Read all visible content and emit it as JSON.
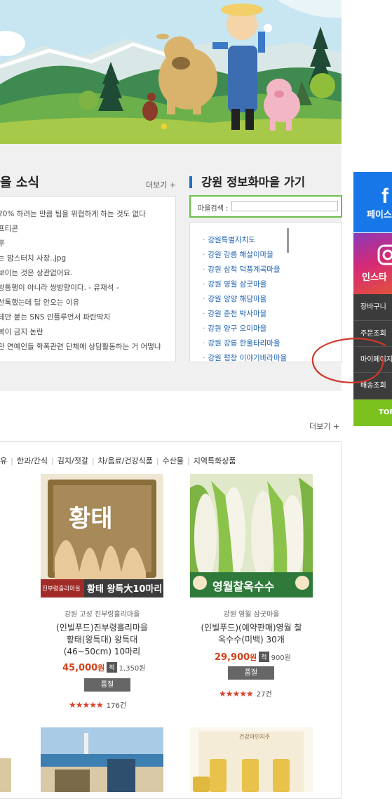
{
  "news": {
    "title": "을 소식",
    "more": "더보기 +",
    "items": [
      "20% 하려는 만큼 팀을 위협하게 하는 것도 없다",
      "프티콘",
      "루",
      "는 맘스터치 사장..jpg",
      "보이는 것은 상관없어요.",
      "방통행이 아니라 쌍방향이다. - 유재석 -",
      "선톡했는데 답 안오는 이유",
      "테만 붙는 SNS 인플루언서 파란딱지",
      "복이 금지 논란",
      "란 연예인들 학폭관련 단체에 상담활동하는 거 어떻냐"
    ]
  },
  "village": {
    "title": "강원 정보화마을 가기",
    "search_label": "마을검색 :",
    "search_value": "",
    "items": [
      "강원특별자치도",
      "강원 강릉 해살이마을",
      "강원 삼척 덕풍계곡마을",
      "강원 영월 삼굿마을",
      "강원 양양 해담마을",
      "강원 춘천 박사마을",
      "강원 양구 오미마을",
      "강원 강릉 한울타리마을",
      "강원 평창 이야기바라마을"
    ]
  },
  "side_panel": {
    "facebook": "페이스",
    "instagram": "인스타",
    "cart": "장바구니",
    "order_check": "주문조회",
    "mypage": "마이페이지",
    "delivery": "배송조회",
    "top": "TOP"
  },
  "products": {
    "more": "더보기 +",
    "categories": [
      "유",
      "한과/간식",
      "김치/젓갈",
      "차/음료/건강식품",
      "수산물",
      "지역특화상품"
    ],
    "items": [
      {
        "image_caption": "황태 왕특大10마리",
        "image_badge": "진부령흘리마을",
        "box_title": "황태",
        "region": "강원 고성 진부령흘리마을",
        "name_lines": [
          "(인빌푸드)진부령흘리마을",
          "황태(왕특대) 왕특대",
          "(46~50cm) 10마리"
        ],
        "price": "45,000",
        "price_unit": "원",
        "points_badge": "적",
        "points": "1,350원",
        "soldout": "품절",
        "rating": 5,
        "stars": "★★★★★",
        "reviews": "176건"
      },
      {
        "image_caption": "영월찰옥수수",
        "region": "강원 영월 삼굿마을",
        "name_lines": [
          "(인빌푸드)(예약판매)영월 찰",
          "옥수수(미백) 30개"
        ],
        "price": "29,900",
        "price_unit": "원",
        "points_badge": "적",
        "points": "900원",
        "soldout": "품절",
        "rating": 4.5,
        "stars": "★★★★★",
        "reviews": "27건"
      }
    ],
    "row2_labels": [
      "건강마인지주"
    ]
  },
  "colors": {
    "accent_blue": "#1e72c8",
    "search_border": "#6cbf4a",
    "price": "#d1431a",
    "facebook": "#1877e8",
    "top_button": "#7cc21f"
  }
}
